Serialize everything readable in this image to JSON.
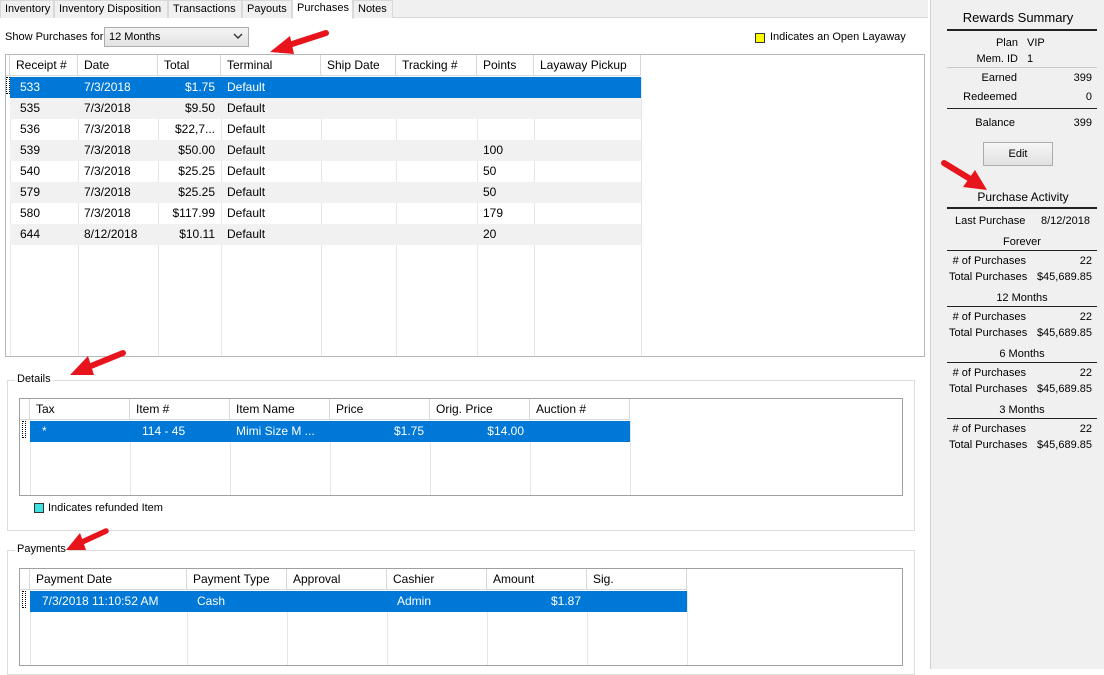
{
  "tabs": [
    "Inventory",
    "Inventory Disposition",
    "Transactions",
    "Payouts",
    "Purchases",
    "Notes"
  ],
  "active_tab": "Purchases",
  "filter": {
    "label": "Show Purchases for",
    "selected": "12 Months"
  },
  "legend_layaway": {
    "text": "Indicates an Open Layaway",
    "color": "#ffff00"
  },
  "purchases": {
    "columns": [
      "Receipt #",
      "Date",
      "Total",
      "Terminal",
      "Ship Date",
      "Tracking #",
      "Points",
      "Layaway Pickup"
    ],
    "rows": [
      [
        "533",
        "7/3/2018",
        "$1.75",
        "Default",
        "",
        "",
        "",
        ""
      ],
      [
        "535",
        "7/3/2018",
        "$9.50",
        "Default",
        "",
        "",
        "",
        ""
      ],
      [
        "536",
        "7/3/2018",
        "$22,7...",
        "Default",
        "",
        "",
        "",
        ""
      ],
      [
        "539",
        "7/3/2018",
        "$50.00",
        "Default",
        "",
        "",
        "100",
        ""
      ],
      [
        "540",
        "7/3/2018",
        "$25.25",
        "Default",
        "",
        "",
        "50",
        ""
      ],
      [
        "579",
        "7/3/2018",
        "$25.25",
        "Default",
        "",
        "",
        "50",
        ""
      ],
      [
        "580",
        "7/3/2018",
        "$117.99",
        "Default",
        "",
        "",
        "179",
        ""
      ],
      [
        "644",
        "8/12/2018",
        "$10.11",
        "Default",
        "",
        "",
        "20",
        ""
      ]
    ]
  },
  "details": {
    "title": "Details",
    "columns": [
      "Tax",
      "Item #",
      "Item Name",
      "Price",
      "Orig. Price",
      "Auction #"
    ],
    "rows": [
      [
        "*",
        "114 - 45",
        "Mimi Size M ...",
        "$1.75",
        "$14.00",
        ""
      ]
    ],
    "legend": {
      "text": "Indicates refunded Item",
      "color": "#40e0e0"
    }
  },
  "payments": {
    "title": "Payments",
    "columns": [
      "Payment Date",
      "Payment Type",
      "Approval",
      "Cashier",
      "Amount",
      "Sig."
    ],
    "rows": [
      [
        "7/3/2018 11:10:52 AM",
        "Cash",
        "",
        "Admin",
        "$1.87",
        ""
      ]
    ]
  },
  "rewards": {
    "title": "Rewards Summary",
    "plan_label": "Plan",
    "plan_value": "VIP",
    "memid_label": "Mem. ID",
    "memid_value": "1",
    "earned_label": "Earned",
    "earned_value": "399",
    "redeemed_label": "Redeemed",
    "redeemed_value": "0",
    "balance_label": "Balance",
    "balance_value": "399",
    "edit_label": "Edit"
  },
  "activity": {
    "title": "Purchase Activity",
    "last_label": "Last Purchase",
    "last_value": "8/12/2018",
    "count_label": "# of Purchases",
    "total_label": "Total Purchases",
    "periods": [
      {
        "name": "Forever",
        "count": "22",
        "total": "$45,689.85"
      },
      {
        "name": "12 Months",
        "count": "22",
        "total": "$45,689.85"
      },
      {
        "name": "6 Months",
        "count": "22",
        "total": "$45,689.85"
      },
      {
        "name": "3 Months",
        "count": "22",
        "total": "$45,689.85"
      }
    ]
  },
  "colors": {
    "selection": "#0078d7",
    "annotation_arrow": "#e8141c"
  },
  "annotation_icons": [
    "red-arrow-icon"
  ]
}
